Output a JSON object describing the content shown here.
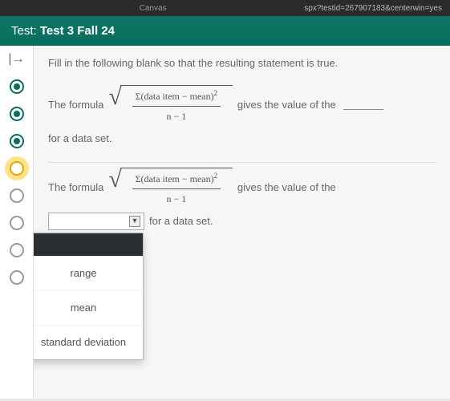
{
  "browser": {
    "tab_hint": "Canvas",
    "url_fragment": "spx?testid=267907183&centerwin=yes"
  },
  "header": {
    "prefix": "Test:",
    "title": "Test 3 Fall 24"
  },
  "nav": {
    "questions": [
      {
        "state": "filled"
      },
      {
        "state": "filled"
      },
      {
        "state": "filled"
      },
      {
        "state": "current"
      },
      {
        "state": "empty"
      },
      {
        "state": "empty"
      },
      {
        "state": "empty"
      },
      {
        "state": "empty"
      }
    ]
  },
  "question": {
    "instruction": "Fill in the following blank so that the resulting statement is true.",
    "lead": "The formula",
    "formula": {
      "sigma": "Σ",
      "inside": "(data item − mean)",
      "exponent": "2",
      "denominator": "n − 1"
    },
    "tail_gives": "gives the value of the",
    "tail_for": "for a data set.",
    "dropdown": {
      "selected": "",
      "options": [
        "range",
        "mean",
        "standard deviation"
      ]
    }
  }
}
